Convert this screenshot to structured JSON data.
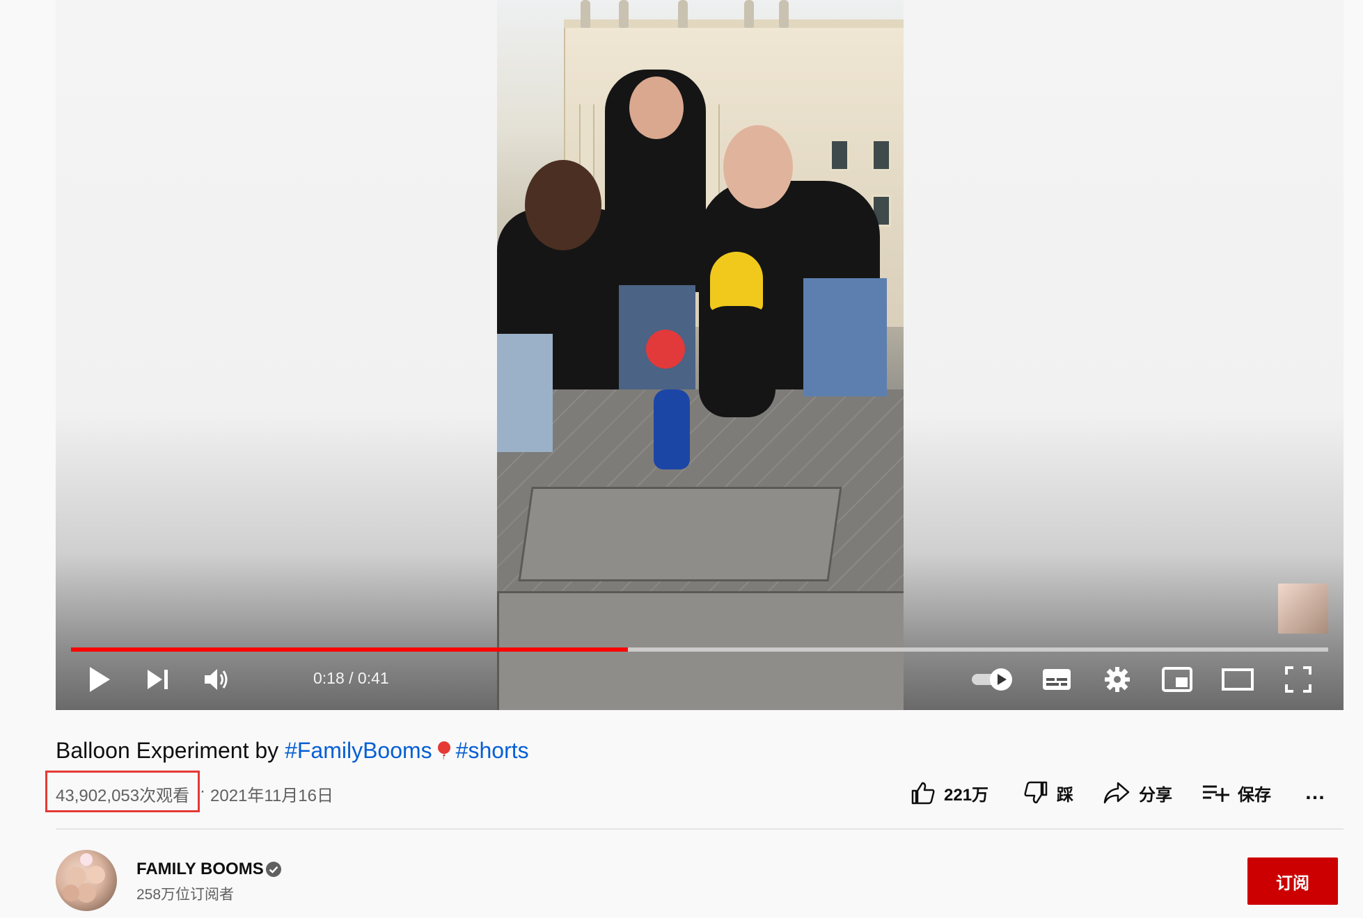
{
  "player": {
    "time": "0:18 / 0:41",
    "progress_fraction": 0.443,
    "icons": [
      "play-icon",
      "next-icon",
      "volume-icon",
      "autoplay-toggle-icon",
      "subtitles-icon",
      "settings-icon",
      "miniplayer-icon",
      "theater-mode-icon",
      "fullscreen-icon"
    ]
  },
  "video": {
    "title_prefix": "Balloon Experiment by ",
    "tag1": "#FamilyBooms",
    "tag2": "#shorts",
    "views": "43,902,053次观看",
    "separator": "·",
    "date": "2021年11月16日"
  },
  "actions": {
    "like": "221万",
    "dislike": "踩",
    "share": "分享",
    "save": "保存",
    "more": "…"
  },
  "channel": {
    "name": "FAMILY BOOMS",
    "subscribers": "258万位订阅者",
    "subscribe_label": "订阅"
  },
  "colors": {
    "accent_red": "#ff0000",
    "subscribe_bg": "#cc0000",
    "link_blue": "#065fd4",
    "highlight_box": "#e53935"
  }
}
